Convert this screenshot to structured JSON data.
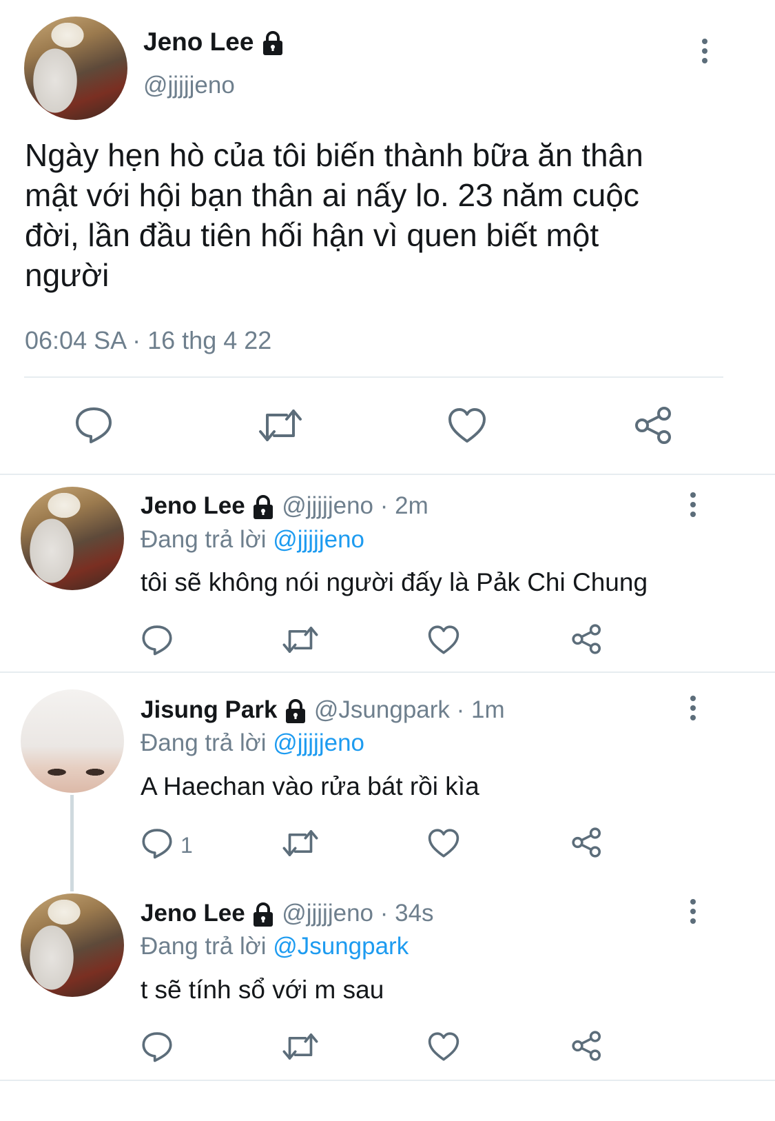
{
  "main_tweet": {
    "name": "Jeno Lee",
    "handle": "@jjjjjeno",
    "text_lines": [
      "Ngày hẹn hò của tôi biến thành bữa ăn thân",
      "mật với hội bạn thân ai nấy lo. 23 năm cuộc",
      "đời, lần đầu tiên hối hận vì quen biết một",
      "người"
    ],
    "timestamp": "06:04 SA · 16 thg 4 22"
  },
  "replies": [
    {
      "name": "Jeno Lee",
      "handle": "@jjjjjeno",
      "time": "· 2m",
      "replying_prefix": "Đang trả lời",
      "replying_to": "@jjjjjeno",
      "text": "tôi sẽ không nói người đấy là Pảk Chi Chung",
      "reply_count": ""
    },
    {
      "name": "Jisung Park",
      "handle": "@Jsungpark",
      "time": "· 1m",
      "replying_prefix": "Đang trả lời",
      "replying_to": "@jjjjjeno",
      "text": "A Haechan vào rửa bát rồi kìa",
      "reply_count": "1"
    },
    {
      "name": "Jeno Lee",
      "handle": "@jjjjjeno",
      "time": "· 34s",
      "replying_prefix": "Đang trả lời",
      "replying_to": "@Jsungpark",
      "text": "t sẽ tính sổ với m sau",
      "reply_count": ""
    }
  ],
  "icons": {
    "reply": "speech-bubble-icon",
    "retweet": "retweet-icon",
    "like": "heart-icon",
    "share": "share-icon",
    "more": "vertical-dots-icon",
    "lock": "lock-icon"
  },
  "colors": {
    "link": "#1d9bf0",
    "secondary_text": "#6e7f8d",
    "icon": "#5c6d7a",
    "divider": "#e6ecf0"
  }
}
